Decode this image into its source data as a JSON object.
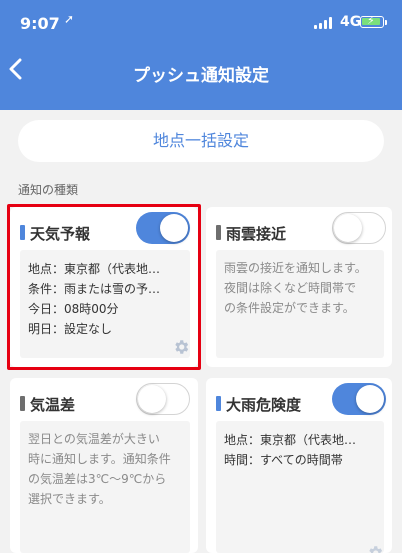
{
  "status_bar": {
    "time": "9:07",
    "network": "4G"
  },
  "nav": {
    "title": "プッシュ通知設定"
  },
  "bulk_button": {
    "label": "地点一括設定"
  },
  "section": {
    "label": "通知の種類"
  },
  "colors": {
    "accent": "#4f86dc",
    "marker_active": "#4f86dc",
    "marker_inactive": "#6e6e6e",
    "highlight": "#e60012"
  },
  "cards": {
    "weather": {
      "title": "天気予報",
      "enabled": true,
      "rows": [
        {
          "label": "地点：",
          "value": "東京都（代表地…"
        },
        {
          "label": "条件：",
          "value": "雨または雪の予…"
        },
        {
          "label": "今日：",
          "value": "08時00分"
        },
        {
          "label": "明日：",
          "value": "設定なし"
        }
      ]
    },
    "rain_cloud": {
      "title": "雨雲接近",
      "enabled": false,
      "description": [
        "雨雲の接近を通知します。",
        "夜間は除くなど時間帯で",
        "の条件設定ができます。"
      ]
    },
    "temp_diff": {
      "title": "気温差",
      "enabled": false,
      "description": [
        "翌日との気温差が大きい",
        "時に通知します。通知条件",
        "の気温差は3℃〜9℃から",
        "選択できます。"
      ]
    },
    "heavy_rain": {
      "title": "大雨危険度",
      "enabled": true,
      "rows": [
        {
          "label": "地点：",
          "value": "東京都（代表地…"
        },
        {
          "label": "時間：",
          "value": "すべての時間帯"
        }
      ]
    }
  }
}
